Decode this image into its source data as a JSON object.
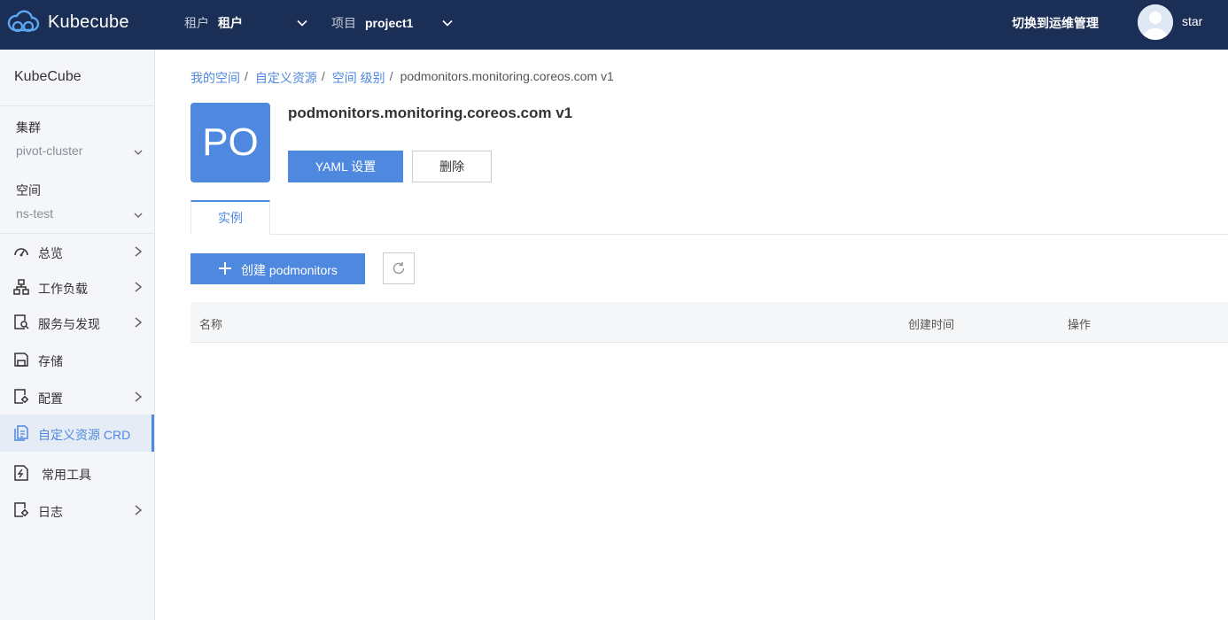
{
  "header": {
    "brand": "Kubecube",
    "tenant_label": "租户",
    "tenant_value": "租户",
    "project_label": "项目",
    "project_value": "project1",
    "ops_link": "切换到运维管理",
    "username": "star"
  },
  "sidebar": {
    "title": "KubeCube",
    "cluster_label": "集群",
    "cluster_value": "pivot-cluster",
    "space_label": "空间",
    "space_value": "ns-test",
    "items": [
      {
        "label": "总览",
        "icon": "dashboard-icon",
        "has_arrow": true
      },
      {
        "label": "工作负载",
        "icon": "workload-icon",
        "has_arrow": true
      },
      {
        "label": "服务与发现",
        "icon": "service-discovery-icon",
        "has_arrow": true
      },
      {
        "label": "存储",
        "icon": "storage-icon",
        "has_arrow": false
      },
      {
        "label": "配置",
        "icon": "config-icon",
        "has_arrow": true
      },
      {
        "label": "自定义资源 CRD",
        "icon": "crd-icon",
        "has_arrow": false,
        "active": true
      },
      {
        "label": "常用工具",
        "icon": "tools-icon",
        "has_arrow": false
      },
      {
        "label": "日志",
        "icon": "log-icon",
        "has_arrow": true
      }
    ]
  },
  "breadcrumb": [
    "我的空间",
    "自定义资源",
    "空间 级别",
    "podmonitors.monitoring.coreos.com v1"
  ],
  "resource": {
    "badge": "PO",
    "title": "podmonitors.monitoring.coreos.com v1",
    "yaml_button": "YAML 设置",
    "delete_button": "删除"
  },
  "tabs": [
    {
      "label": "实例",
      "active": true
    }
  ],
  "instances": {
    "create_button": "创建 podmonitors",
    "columns": [
      "名称",
      "创建时间",
      "操作"
    ],
    "rows": []
  },
  "colors": {
    "topbar": "#1b2f56",
    "accent": "#4f88df",
    "sidebar_bg": "#f4f6f9"
  }
}
